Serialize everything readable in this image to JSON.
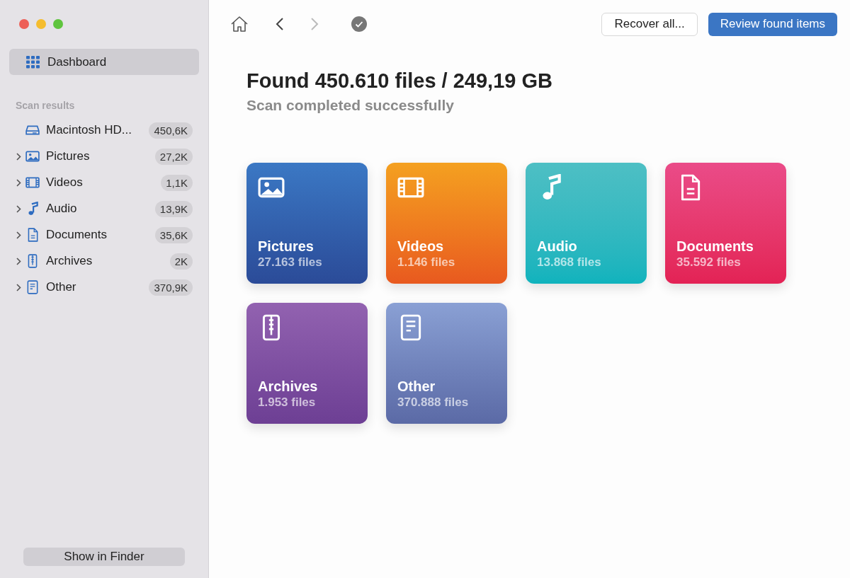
{
  "window": {
    "controls": [
      {
        "color": "#ed5f57"
      },
      {
        "color": "#f5bd2f"
      },
      {
        "color": "#5fc43e"
      }
    ]
  },
  "sidebar": {
    "nav": [
      {
        "label": "Dashboard",
        "selected": true
      }
    ],
    "section_title": "Scan results",
    "items": [
      {
        "kind": "disk",
        "label": "Macintosh HD...",
        "count": "450,6K"
      },
      {
        "kind": "pictures",
        "label": "Pictures",
        "count": "27,2K",
        "expanded": false
      },
      {
        "kind": "videos",
        "label": "Videos",
        "count": "1,1K",
        "expanded": false
      },
      {
        "kind": "audio",
        "label": "Audio",
        "count": "13,9K",
        "expanded": false
      },
      {
        "kind": "documents",
        "label": "Documents",
        "count": "35,6K",
        "expanded": false
      },
      {
        "kind": "archives",
        "label": "Archives",
        "count": "2K",
        "expanded": false
      },
      {
        "kind": "other",
        "label": "Other",
        "count": "370,9K",
        "expanded": false
      }
    ],
    "footer_button": "Show in Finder"
  },
  "toolbar": {
    "back_enabled": true,
    "forward_enabled": false,
    "buttons": [
      {
        "label": "Recover all...",
        "kind": "secondary"
      },
      {
        "label": "Review found items",
        "kind": "primary"
      }
    ]
  },
  "summary": {
    "title": "Found 450.610 files / 249,19 GB",
    "subtitle": "Scan completed successfully"
  },
  "cards": [
    {
      "kind": "pictures",
      "label": "Pictures",
      "count": "27.163 files"
    },
    {
      "kind": "videos",
      "label": "Videos",
      "count": "1.146 files"
    },
    {
      "kind": "audio",
      "label": "Audio",
      "count": "13.868 files"
    },
    {
      "kind": "documents",
      "label": "Documents",
      "count": "35.592 files"
    },
    {
      "kind": "archives",
      "label": "Archives",
      "count": "1.953 files"
    },
    {
      "kind": "other",
      "label": "Other",
      "count": "370.888 files"
    }
  ]
}
